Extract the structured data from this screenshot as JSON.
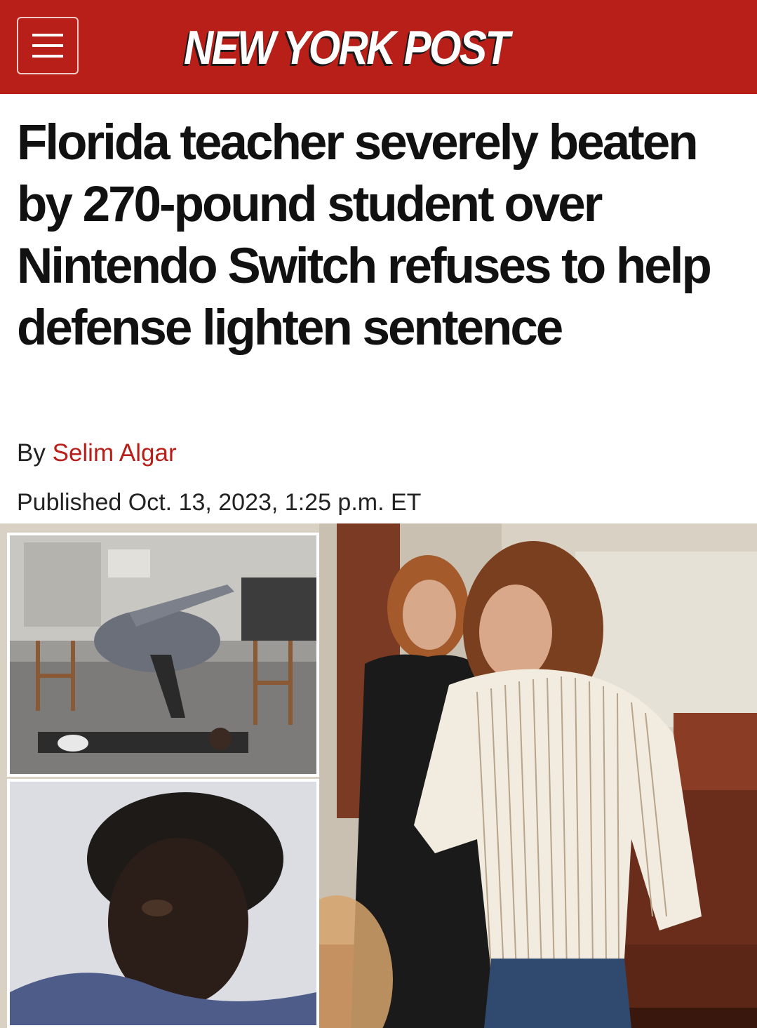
{
  "header": {
    "menu_icon": "hamburger-menu-icon",
    "logo_text": "NEW YORK POST",
    "background_color": "#b81f18"
  },
  "article": {
    "headline": "Florida teacher severely beaten by 270-pound student over Nintendo Switch refuses to help defense lighten sentence",
    "byline_prefix": "By",
    "author": "Selim Algar",
    "author_color": "#b81f18",
    "published": "Published Oct. 13, 2023, 1:25 p.m. ET"
  },
  "images": {
    "main": "courtroom-photo",
    "inset_top": "surveillance-still",
    "inset_bottom": "student-photo"
  }
}
